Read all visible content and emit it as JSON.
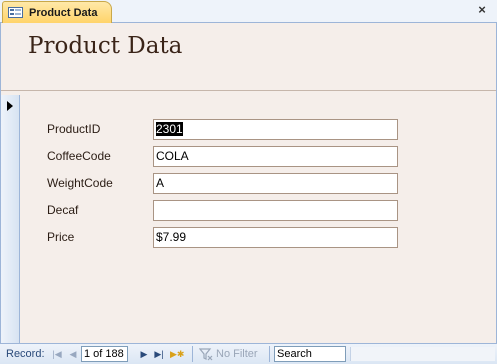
{
  "tab": {
    "label": "Product Data",
    "icon": "form-icon",
    "close_label": "×"
  },
  "form": {
    "title": "Product Data",
    "fields": [
      {
        "label": "ProductID",
        "value": "2301",
        "selected": true
      },
      {
        "label": "CoffeeCode",
        "value": "COLA"
      },
      {
        "label": "WeightCode",
        "value": "A"
      },
      {
        "label": "Decaf",
        "value": ""
      },
      {
        "label": "Price",
        "value": "$7.99"
      }
    ]
  },
  "navigation": {
    "record_label": "Record:",
    "record_position": "1 of 188",
    "filter_label": "No Filter",
    "search_label": "Search"
  },
  "colors": {
    "form_background": "#f5eeea",
    "title_color": "#3a2418",
    "tab_active": "#ffd46a"
  }
}
